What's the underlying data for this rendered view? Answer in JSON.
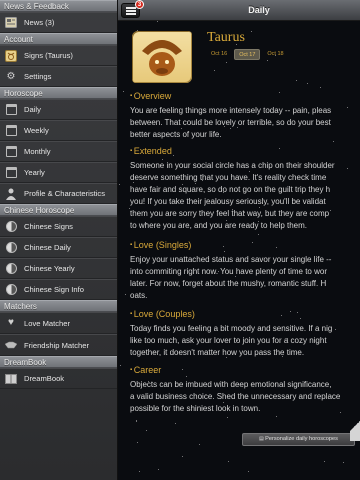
{
  "sidebar": {
    "sections": [
      {
        "header": "News & Feedback",
        "items": [
          {
            "label": "News (3)",
            "icon": "news-icon"
          }
        ]
      },
      {
        "header": "Account",
        "items": [
          {
            "label": "Signs (Taurus)",
            "icon": "signs-icon"
          },
          {
            "label": "Settings",
            "icon": "gear-icon"
          }
        ]
      },
      {
        "header": "Horoscope",
        "items": [
          {
            "label": "Daily",
            "icon": "calendar-icon"
          },
          {
            "label": "Weekly",
            "icon": "calendar-icon"
          },
          {
            "label": "Monthly",
            "icon": "calendar-icon"
          },
          {
            "label": "Yearly",
            "icon": "calendar-icon"
          },
          {
            "label": "Profile & Characteristics",
            "icon": "person-icon"
          }
        ]
      },
      {
        "header": "Chinese Horoscope",
        "items": [
          {
            "label": "Chinese Signs",
            "icon": "yin-yang-icon"
          },
          {
            "label": "Chinese Daily",
            "icon": "yin-yang-icon"
          },
          {
            "label": "Chinese Yearly",
            "icon": "yin-yang-icon"
          },
          {
            "label": "Chinese Sign Info",
            "icon": "yin-yang-icon"
          }
        ]
      },
      {
        "header": "Matchers",
        "items": [
          {
            "label": "Love Matcher",
            "icon": "heart-icon"
          },
          {
            "label": "Friendship Matcher",
            "icon": "handshake-icon"
          }
        ]
      },
      {
        "header": "DreamBook",
        "items": [
          {
            "label": "DreamBook",
            "icon": "book-icon"
          }
        ]
      }
    ]
  },
  "topbar": {
    "title": "Daily",
    "badge": "3"
  },
  "sign": {
    "name": "Taurus",
    "dates": [
      "Oct 16",
      "Oct 17",
      "Oct 18"
    ],
    "selected_date": "Oct 17"
  },
  "sections": [
    {
      "title": "Overview",
      "lines": [
        "You are feeling things more intensely today -- pain, pleas",
        "between. That could be lovely or terrible, so do your best",
        "better aspects of your life."
      ]
    },
    {
      "title": "Extended",
      "lines": [
        "Someone in your social circle has a chip on their shoulder",
        "deserve something that you have. It's reality check time",
        "have fair and square, so do not go on the guilt trip they h",
        "you! If you take their jealousy seriously, you'll be validat",
        "them you are sorry they feel that way, but they are comp",
        "to where you are, and you are ready to help them."
      ]
    },
    {
      "title": "Love (Singles)",
      "lines": [
        "Enjoy your unattached status and savor your single life --",
        "into commiting right now. You have plenty of time to wor",
        "later. For now, forget about the mushy, romantic stuff. H",
        "oats."
      ]
    },
    {
      "title": "Love (Couples)",
      "lines": [
        "Today finds you feeling a bit moody and sensitive. If a nig",
        "like too much, ask your lover to join you for a cozy night",
        "together, it doesn't matter how you pass the time."
      ]
    },
    {
      "title": "Career",
      "lines": [
        "Objects can be imbued with deep emotional significance,",
        "a valid business choice. Shed the unnecessary and replace",
        "possible for the shiniest look in town."
      ]
    }
  ],
  "personalize_label": "Personalize daily horoscopes",
  "colors": {
    "accent_gold": "#d9a93a",
    "sidebar_bg": "#2f3033",
    "section_header_bg": "#7d8085",
    "content_bg": "#0a0c10"
  }
}
